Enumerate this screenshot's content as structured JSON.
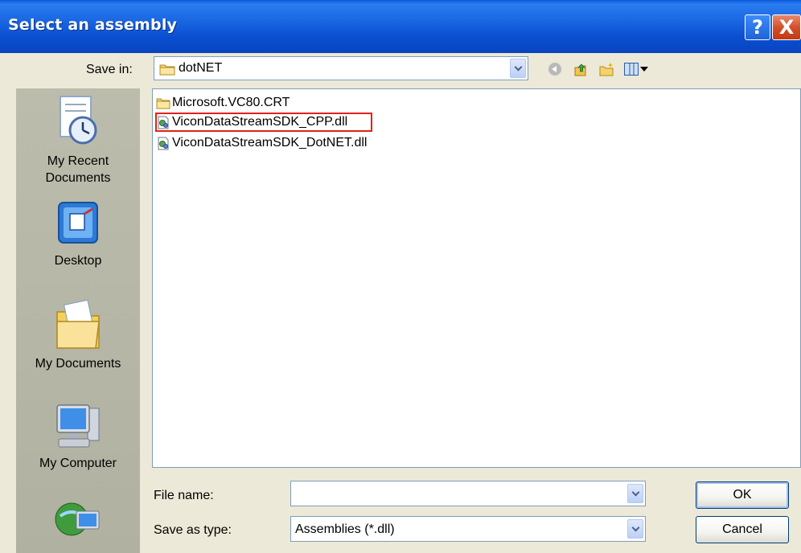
{
  "window": {
    "title": "Select an assembly"
  },
  "titlebar_buttons": {
    "help": "?",
    "close": "X"
  },
  "save_in": {
    "label": "Save in:",
    "value": "dotNET"
  },
  "places": [
    {
      "label_line1": "My Recent",
      "label_line2": "Documents"
    },
    {
      "label_line1": "Desktop",
      "label_line2": ""
    },
    {
      "label_line1": "My Documents",
      "label_line2": ""
    },
    {
      "label_line1": "My Computer",
      "label_line2": ""
    }
  ],
  "files": [
    {
      "name": "Microsoft.VC80.CRT",
      "type": "folder",
      "highlighted": false
    },
    {
      "name": "ViconDataStreamSDK_CPP.dll",
      "type": "dll",
      "highlighted": true
    },
    {
      "name": "ViconDataStreamSDK_DotNET.dll",
      "type": "dll",
      "highlighted": false
    }
  ],
  "file_name": {
    "label": "File name:",
    "value": ""
  },
  "save_as_type": {
    "label": "Save as type:",
    "value": "Assemblies (*.dll)"
  },
  "buttons": {
    "ok": "OK",
    "cancel": "Cancel"
  },
  "colors": {
    "title_bar": "#0a4fd0",
    "dialog_bg": "#ece9d8",
    "highlight_outline": "#e0221a",
    "places_bar": "#b1b1a1"
  }
}
